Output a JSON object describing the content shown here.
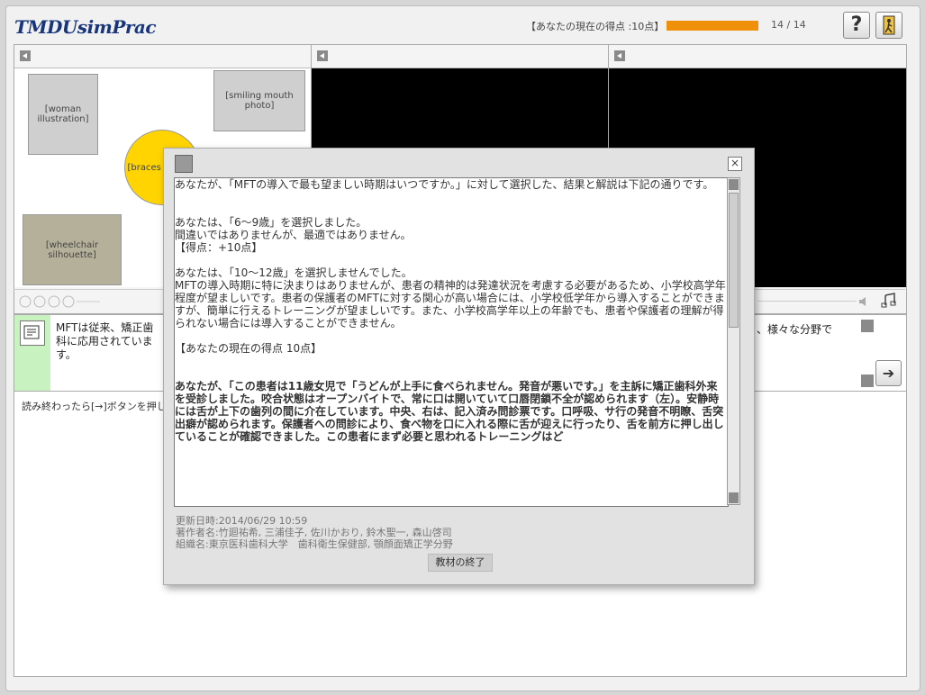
{
  "header": {
    "logo": "TMDUsimPrac",
    "score_label": "【あなたの現在の得点 :10点】",
    "progress_fraction": 1.0,
    "progress_count": "14 / 14",
    "help_label": "?",
    "exit_icon": "exit-door-icon"
  },
  "panels": {
    "back_icon": "arrow-left-icon"
  },
  "text_area": {
    "note_text": "MFTは従来、矯正歯科に応用されています。",
    "note_text_right": "、様々な分野で",
    "next_icon": "arrow-right-icon",
    "next_label": "➔"
  },
  "lower": {
    "instruction": "読み終わったら[→]ボタンを押して"
  },
  "modal": {
    "close_label": "×",
    "intro": "あなたが、「MFTの導入で最も望ましい時期はいつですか。」に対して選択した、結果と解説は下記の通りです。",
    "selected": "あなたは、「6〜9歳」を選択しました。",
    "selected_note": "間違いではありませんが、最適ではありません。",
    "selected_score": "【得点：+10点】",
    "not_selected": "あなたは、「10〜12歳」を選択しませんでした。",
    "explanation": "MFTの導入時期に特に決まりはありませんが、患者の精神的は発達状況を考慮する必要があるため、小学校高学年程度が望ましいです。患者の保護者のMFTに対する関心が高い場合には、小学校低学年から導入することができますが、簡単に行えるトレーニングが望ましいです。また、小学校高学年以上の年齢でも、患者や保護者の理解が得られない場合には導入することができません。",
    "current_score": "【あなたの現在の得点 10点】",
    "next_question": "あなたが、「この患者は11歳女児で「うどんが上手に食べられません。発音が悪いです。」を主訴に矯正歯科外来を受診しました。咬合状態はオープンバイトで、常に口は開いていて口唇閉鎖不全が認められます（左）。安静時には舌が上下の歯列の間に介在しています。中央、右は、記入済み問診票です。口呼吸、サ行の発音不明瞭、舌突出癖が認められます。保護者への問診により、食べ物を口に入れる際に舌が迎えに行ったり、舌を前方に押し出していることが確認できました。この患者にまず必要と思われるトレーニングはど",
    "updated": "更新日時:2014/06/29 10:59",
    "authors": "著作者名:竹廻祐希, 三浦佳子, 佐川かおり, 鈴木聖一, 森山啓司",
    "organization": "組織名:東京医科歯科大学　歯科衛生保健部, 顎顔面矯正学分野",
    "finish_label": "教材の終了"
  },
  "images": {
    "woman": "[woman illustration]",
    "smile": "[smiling mouth photo]",
    "emoji": "[braces smiley]",
    "wheelchair": "[wheelchair silhouette]"
  }
}
